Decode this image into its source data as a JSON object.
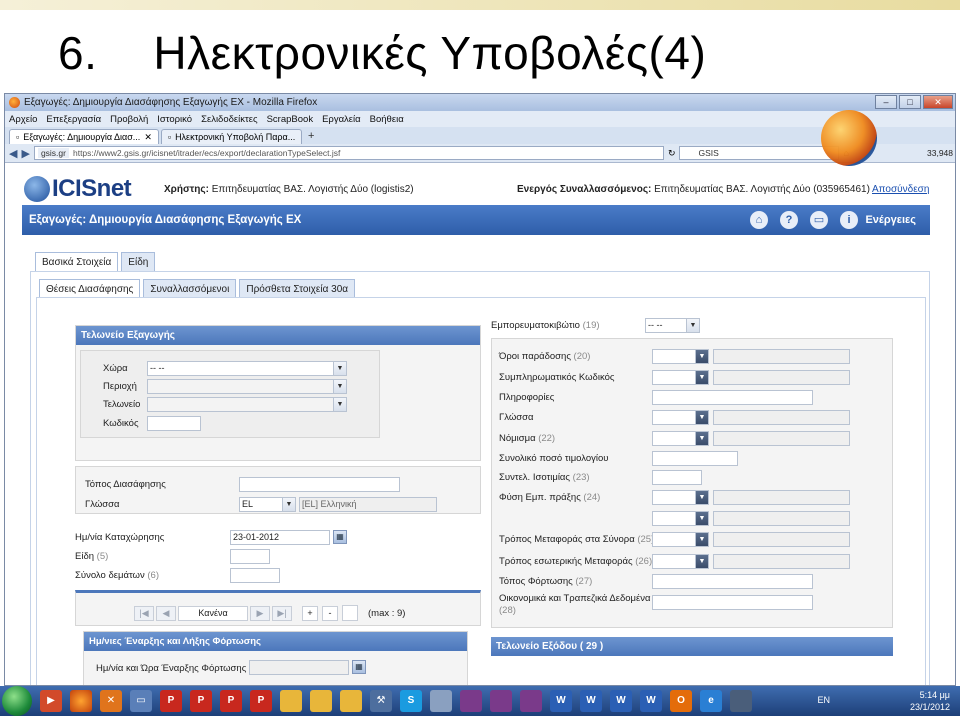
{
  "slide": {
    "number": "6.",
    "title": "Ηλεκτρονικές Υποβολές(4)"
  },
  "browser": {
    "window_title": "Εξαγωγές: Δημιουργία Διασάφησης Εξαγωγής ΕΧ - Mozilla Firefox",
    "menu": [
      "Αρχείο",
      "Επεξεργασία",
      "Προβολή",
      "Ιστορικό",
      "Σελιδοδείκτες",
      "ScrapBook",
      "Εργαλεία",
      "Βοήθεια"
    ],
    "tabs": [
      {
        "label": "Εξαγωγές: Δημιουργία Διασ...",
        "active": true
      },
      {
        "label": "Ηλεκτρονική Υποβολή Παρα...",
        "active": false
      }
    ],
    "new_tab": "+",
    "url_site": "gsis.gr",
    "url": "https://www2.gsis.gr/icisnet/itrader/ecs/export/declarationTypeSelect.jsf",
    "search_text": "GSIS",
    "counter": "33,948"
  },
  "app": {
    "logo_text": "ICISnet",
    "user_label": "Χρήστης:",
    "user_value": "Επιτηδευματίας ΒΑΣ. Λογιστής Δύο (logistis2)",
    "agent_label": "Ενεργός Συναλλασσόμενος:",
    "agent_value": "Επιτηδευματίας ΒΑΣ. Λογιστής Δύο (035965461)",
    "logout": "Αποσύνδεση",
    "page_title": "Εξαγωγές: Δημιουργία Διασάφησης Εξαγωγής ΕΧ",
    "actions": "Ενέργειες",
    "main_tabs": [
      "Βασικά Στοιχεία",
      "Είδη"
    ],
    "sub_tabs": [
      "Θέσεις Διασάφησης",
      "Συναλλασσόμενοι",
      "Πρόσθετα Στοιχεία 30α"
    ]
  },
  "form": {
    "export_office_header": "Τελωνείο Εξαγωγής",
    "country_label": "Χώρα",
    "country_value": "-- --",
    "region_label": "Περιοχή",
    "office_label": "Τελωνείο",
    "code_label": "Κωδικός",
    "place_label": "Τόπος Διασάφησης",
    "language_label": "Γλώσσα",
    "language_code": "EL",
    "language_text": "[EL] Ελληνική",
    "reg_date_label": "Ημ/νία Καταχώρησης",
    "reg_date_value": "23-01-2012",
    "items_label": "Είδη",
    "items_hint": "(5)",
    "packages_label": "Σύνολο δεμάτων",
    "packages_hint": "(6)",
    "pager_value": "Κανένα",
    "pager_max": "(max : 9)",
    "pager_plus": "+",
    "pager_minus": "-",
    "dates_header": "Ημ/νιες Έναρξης και Λήξης Φόρτωσης",
    "load_start_label": "Ημ/νία και Ώρα Έναρξης Φόρτωσης",
    "container_label": "Εμπορευματοκιβώτιο",
    "container_hint": "(19)",
    "container_value": "-- --",
    "delivery_label": "Όροι παράδοσης",
    "delivery_hint": "(20)",
    "suppl_code_label": "Συμπληρωματικός Κωδικός",
    "info_label": "Πληροφορίες",
    "lang2_label": "Γλώσσα",
    "currency_label": "Νόμισμα",
    "currency_hint": "(22)",
    "invoice_total_label": "Συνολικό ποσό τιμολογίου",
    "rate_label": "Συντελ. Ισοτιμίας",
    "rate_hint": "(23)",
    "transaction_label": "Φύση Εμπ. πράξης",
    "transaction_hint": "(24)",
    "border_transport_label": "Τρόπος Μεταφοράς στα Σύνορα",
    "border_transport_hint": "(25)",
    "inland_transport_label": "Τρόπος εσωτερικής Μεταφοράς",
    "inland_transport_hint": "(26)",
    "loading_place_label": "Τόπος Φόρτωσης",
    "loading_place_hint": "(27)",
    "financial_label": "Οικονομικά και Τραπεζικά Δεδομένα",
    "financial_hint": "(28)",
    "exit_office_header": "Τελωνείο Εξόδου ( 29 )"
  },
  "taskbar": {
    "lang": "EN",
    "time": "5:14 μμ",
    "date": "23/1/2012"
  }
}
